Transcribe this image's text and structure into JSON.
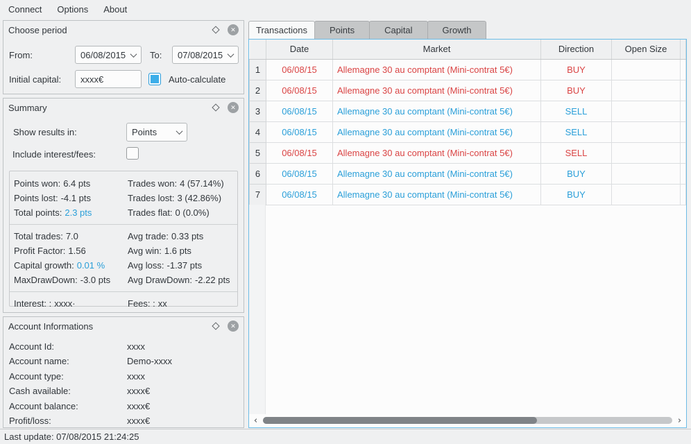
{
  "colors": {
    "accent_blue": "#2a9fd9",
    "negative_red": "#da4444",
    "focus_border": "#6cbce6",
    "checkbox_checked": "#3daee9"
  },
  "menu": {
    "items": [
      {
        "label": "Connect"
      },
      {
        "label": "Options"
      },
      {
        "label": "About"
      }
    ]
  },
  "choose_period": {
    "title": "Choose period",
    "from_label": "From:",
    "from_value": "06/08/2015",
    "to_label": "To:",
    "to_value": "07/08/2015",
    "capital_label": "Initial capital:",
    "capital_value": "xxxx€",
    "auto_calculate_label": "Auto-calculate"
  },
  "summary": {
    "title": "Summary",
    "show_results_label": "Show results in:",
    "show_results_value": "Points",
    "include_fees_label": "Include interest/fees:",
    "stats": [
      {
        "cls": "",
        "l_label": "Points won:",
        "l_value": "6.4 pts",
        "l_cls": "",
        "r_label": "Trades won:",
        "r_value": "4 (57.14%)",
        "r_cls": ""
      },
      {
        "cls": "",
        "l_label": "Points lost:",
        "l_value": "-4.1 pts",
        "l_cls": "",
        "r_label": "Trades lost:",
        "r_value": "3 (42.86%)",
        "r_cls": ""
      },
      {
        "cls": "",
        "l_label": "Total points:",
        "l_value": "2.3 pts",
        "l_cls": "hl",
        "r_label": "Trades flat:",
        "r_value": "0 (0.0%)",
        "r_cls": ""
      },
      {
        "cls": "sep",
        "l_label": "Total trades:",
        "l_value": "7.0",
        "l_cls": "",
        "r_label": "Avg trade:",
        "r_value": "0.33 pts",
        "r_cls": ""
      },
      {
        "cls": "",
        "l_label": "Profit Factor:",
        "l_value": "1.56",
        "l_cls": "",
        "r_label": "Avg win:",
        "r_value": "1.6 pts",
        "r_cls": ""
      },
      {
        "cls": "",
        "l_label": "Capital growth:",
        "l_value": "0.01 %",
        "l_cls": "hl",
        "r_label": "Avg loss:",
        "r_value": "-1.37 pts",
        "r_cls": ""
      },
      {
        "cls": "",
        "l_label": "MaxDrawDown:",
        "l_value": "-3.0 pts",
        "l_cls": "",
        "r_label": "Avg DrawDown:",
        "r_value": "-2.22 pts",
        "r_cls": ""
      },
      {
        "cls": "sep",
        "l_label": "Interest: :",
        "l_value": "xxxx·",
        "l_cls": "",
        "r_label": "Fees: :",
        "r_value": "xx",
        "r_cls": ""
      }
    ]
  },
  "account": {
    "title": "Account Informations",
    "rows": [
      {
        "label": "Account Id:",
        "value": "xxxx"
      },
      {
        "label": "Account name:",
        "value": "Demo-xxxx"
      },
      {
        "label": "Account type:",
        "value": "xxxx"
      },
      {
        "label": "Cash available:",
        "value": "xxxx€"
      },
      {
        "label": "Account balance:",
        "value": "xxxx€"
      },
      {
        "label": "Profit/loss:",
        "value": "xxxx€"
      }
    ]
  },
  "tabs": {
    "items": [
      {
        "label": "Transactions",
        "cls": "active"
      },
      {
        "label": "Points",
        "cls": ""
      },
      {
        "label": "Capital",
        "cls": ""
      },
      {
        "label": "Growth",
        "cls": ""
      }
    ]
  },
  "table": {
    "columns": {
      "date": "Date",
      "market": "Market",
      "direction": "Direction",
      "open_size": "Open Size"
    },
    "rows": [
      {
        "num": "1",
        "date": "06/08/15",
        "market": "Allemagne 30 au comptant (Mini-contrat 5€)",
        "direction": "BUY",
        "cls": "row-red"
      },
      {
        "num": "2",
        "date": "06/08/15",
        "market": "Allemagne 30 au comptant (Mini-contrat 5€)",
        "direction": "BUY",
        "cls": "row-red"
      },
      {
        "num": "3",
        "date": "06/08/15",
        "market": "Allemagne 30 au comptant (Mini-contrat 5€)",
        "direction": "SELL",
        "cls": "row-blue"
      },
      {
        "num": "4",
        "date": "06/08/15",
        "market": "Allemagne 30 au comptant (Mini-contrat 5€)",
        "direction": "SELL",
        "cls": "row-blue"
      },
      {
        "num": "5",
        "date": "06/08/15",
        "market": "Allemagne 30 au comptant (Mini-contrat 5€)",
        "direction": "SELL",
        "cls": "row-red"
      },
      {
        "num": "6",
        "date": "06/08/15",
        "market": "Allemagne 30 au comptant (Mini-contrat 5€)",
        "direction": "BUY",
        "cls": "row-blue"
      },
      {
        "num": "7",
        "date": "06/08/15",
        "market": "Allemagne 30 au comptant (Mini-contrat 5€)",
        "direction": "BUY",
        "cls": "row-blue"
      }
    ]
  },
  "status": {
    "last_update": "Last update: 07/08/2015 21:24:25"
  }
}
